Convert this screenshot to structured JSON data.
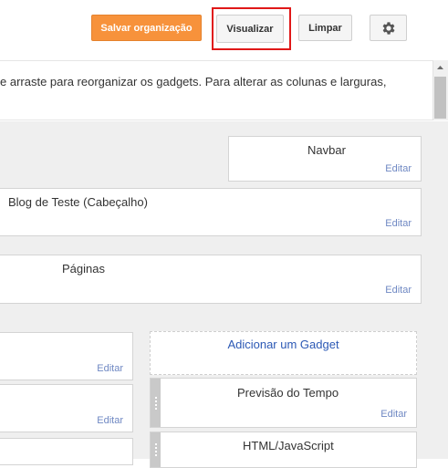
{
  "toolbar": {
    "save_label": "Salvar organização",
    "preview_label": "Visualizar",
    "clear_label": "Limpar",
    "settings_icon": "gear-icon"
  },
  "info": {
    "text": "e arraste para reorganizar os gadgets. Para alterar as colunas e larguras,"
  },
  "gadgets": {
    "navbar": {
      "title": "Navbar",
      "edit": "Editar"
    },
    "header": {
      "title": "Blog de Teste (Cabeçalho)",
      "edit": "Editar"
    },
    "pages": {
      "title": "Páginas",
      "edit": "Editar"
    },
    "left1": {
      "edit": "Editar"
    },
    "left2": {
      "edit": "Editar"
    },
    "add_gadget": "Adicionar um Gadget",
    "weather": {
      "title": "Previsão do Tempo",
      "edit": "Editar"
    },
    "html": {
      "title": "HTML/JavaScript"
    }
  },
  "colors": {
    "accent": "#f7923b",
    "highlight": "#e01818",
    "link": "#6f88c3",
    "add_link": "#2c59b5"
  }
}
